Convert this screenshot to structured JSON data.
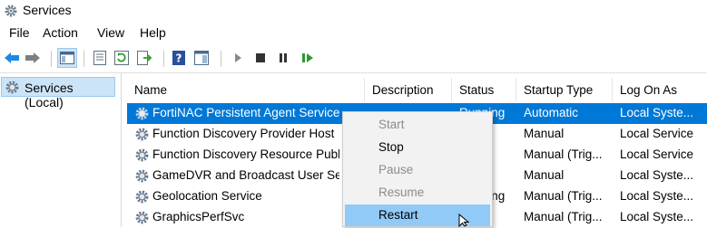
{
  "window": {
    "title": "Services",
    "icon": "gear-icon"
  },
  "menu": [
    "File",
    "Action",
    "View",
    "Help"
  ],
  "toolbar": {
    "icons": [
      "back-arrow-icon",
      "forward-arrow-icon",
      "show-hide-console-tree-icon",
      "properties-icon",
      "refresh-icon",
      "export-list-icon",
      "help-icon",
      "action-pane-icon",
      "start-service-icon",
      "stop-service-icon",
      "pause-service-icon",
      "restart-service-icon"
    ]
  },
  "tree": {
    "selected": "Services (Local)"
  },
  "columns": [
    "Name",
    "Description",
    "Status",
    "Startup Type",
    "Log On As"
  ],
  "rows": [
    {
      "name": "FortiNAC Persistent Agent Service",
      "description": "",
      "status": "Running",
      "startup": "Automatic",
      "logon": "Local Syste..."
    },
    {
      "name": "Function Discovery Provider Host",
      "description": "",
      "status": "",
      "startup": "Manual",
      "logon": "Local Service"
    },
    {
      "name": "Function Discovery Resource Publ",
      "description": "",
      "status": "",
      "startup": "Manual (Trig...",
      "logon": "Local Service"
    },
    {
      "name": "GameDVR and Broadcast User Serv",
      "description": "",
      "status": "",
      "startup": "Manual",
      "logon": "Local Syste..."
    },
    {
      "name": "Geolocation Service",
      "description": "",
      "status": "Running",
      "startup": "Manual (Trig...",
      "logon": "Local Syste..."
    },
    {
      "name": "GraphicsPerfSvc",
      "description": "",
      "status": "",
      "startup": "Manual (Trig...",
      "logon": "Local Syste..."
    }
  ],
  "context_menu": [
    {
      "label": "Start",
      "enabled": false
    },
    {
      "label": "Stop",
      "enabled": true
    },
    {
      "label": "Pause",
      "enabled": false
    },
    {
      "label": "Resume",
      "enabled": false
    },
    {
      "label": "Restart",
      "enabled": true,
      "hovered": true
    }
  ],
  "colors": {
    "selection": "#0078d7",
    "tree_selection": "#cce4f7",
    "menu_hover": "#91c9f7"
  }
}
